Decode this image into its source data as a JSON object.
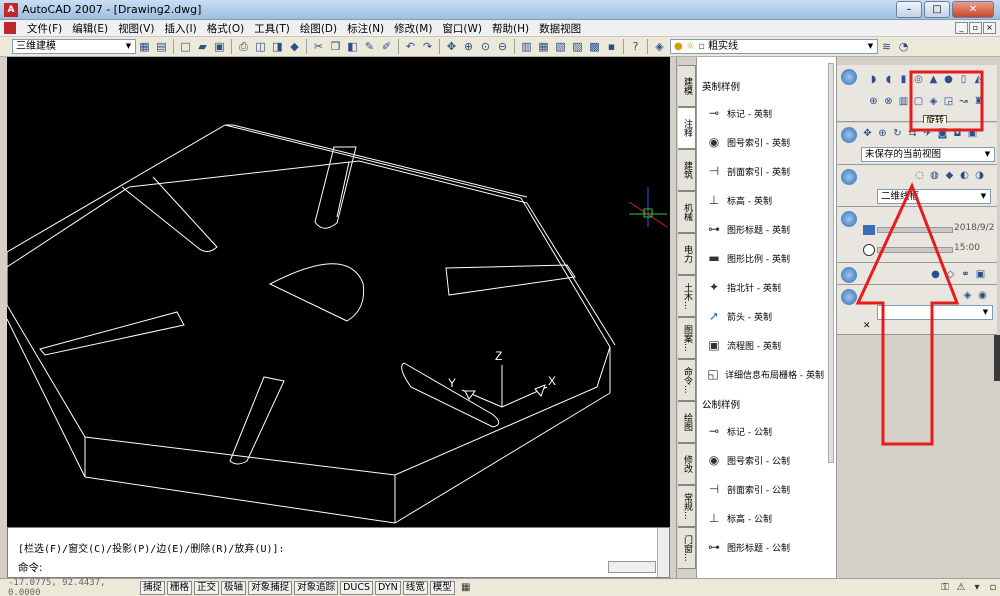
{
  "window": {
    "title": "AutoCAD 2007 - [Drawing2.dwg]",
    "app_icon": "autocad-logo",
    "controls": [
      "–",
      "□",
      "✕"
    ]
  },
  "menu": [
    "文件(F)",
    "编辑(E)",
    "视图(V)",
    "插入(I)",
    "格式(O)",
    "工具(T)",
    "绘图(D)",
    "标注(N)",
    "修改(M)",
    "窗口(W)",
    "帮助(H)",
    "数据视图"
  ],
  "toolbar": {
    "workspace": "三维建模",
    "linetype": "粗实线"
  },
  "drawing": {
    "ucs": {
      "z": "Z",
      "y": "Y",
      "x": "X"
    }
  },
  "command": {
    "history": "[栏选(F)/窗交(C)/投影(P)/边(E)/删除(R)/放弃(U)]:",
    "prompt": "命令:"
  },
  "status": {
    "coords": "-17.0775, 92.4437, 0.0000",
    "buttons": [
      "捕捉",
      "栅格",
      "正交",
      "极轴",
      "对象捕捉",
      "对象追踪",
      "DUCS",
      "DYN",
      "线宽",
      "模型"
    ]
  },
  "palette": {
    "tabs": [
      "建模",
      "注释",
      "建筑",
      "机械",
      "电力",
      "土木...",
      "图案...",
      "命令...",
      "绘图",
      "修改",
      "常规...",
      "门窗..."
    ],
    "sections": {
      "imperial": "英制样例",
      "metric": "公制样例"
    },
    "imperial_items": [
      "标记 - 英制",
      "图号索引 - 英制",
      "剖面索引 - 英制",
      "标高 - 英制",
      "图形标题 - 英制",
      "图形比例 - 英制",
      "指北针 - 英制",
      "箭头 - 英制",
      "流程图 - 英制",
      "详细信息布局栅格 - 英制"
    ],
    "metric_items": [
      "标记 - 公制",
      "图号索引 - 公制",
      "剖面索引 - 公制",
      "标高 - 公制",
      "图形标题 - 公制"
    ]
  },
  "dashboard": {
    "view_combo": "未保存的当前视图",
    "visual_style_combo": "二维线框",
    "date_value": "2018/9/2",
    "time_value": "15:00",
    "tooltip": "旋转"
  },
  "colors": {
    "highlight": "#e51c1c",
    "model_bg": "#000000",
    "wire": "#ffffff"
  }
}
